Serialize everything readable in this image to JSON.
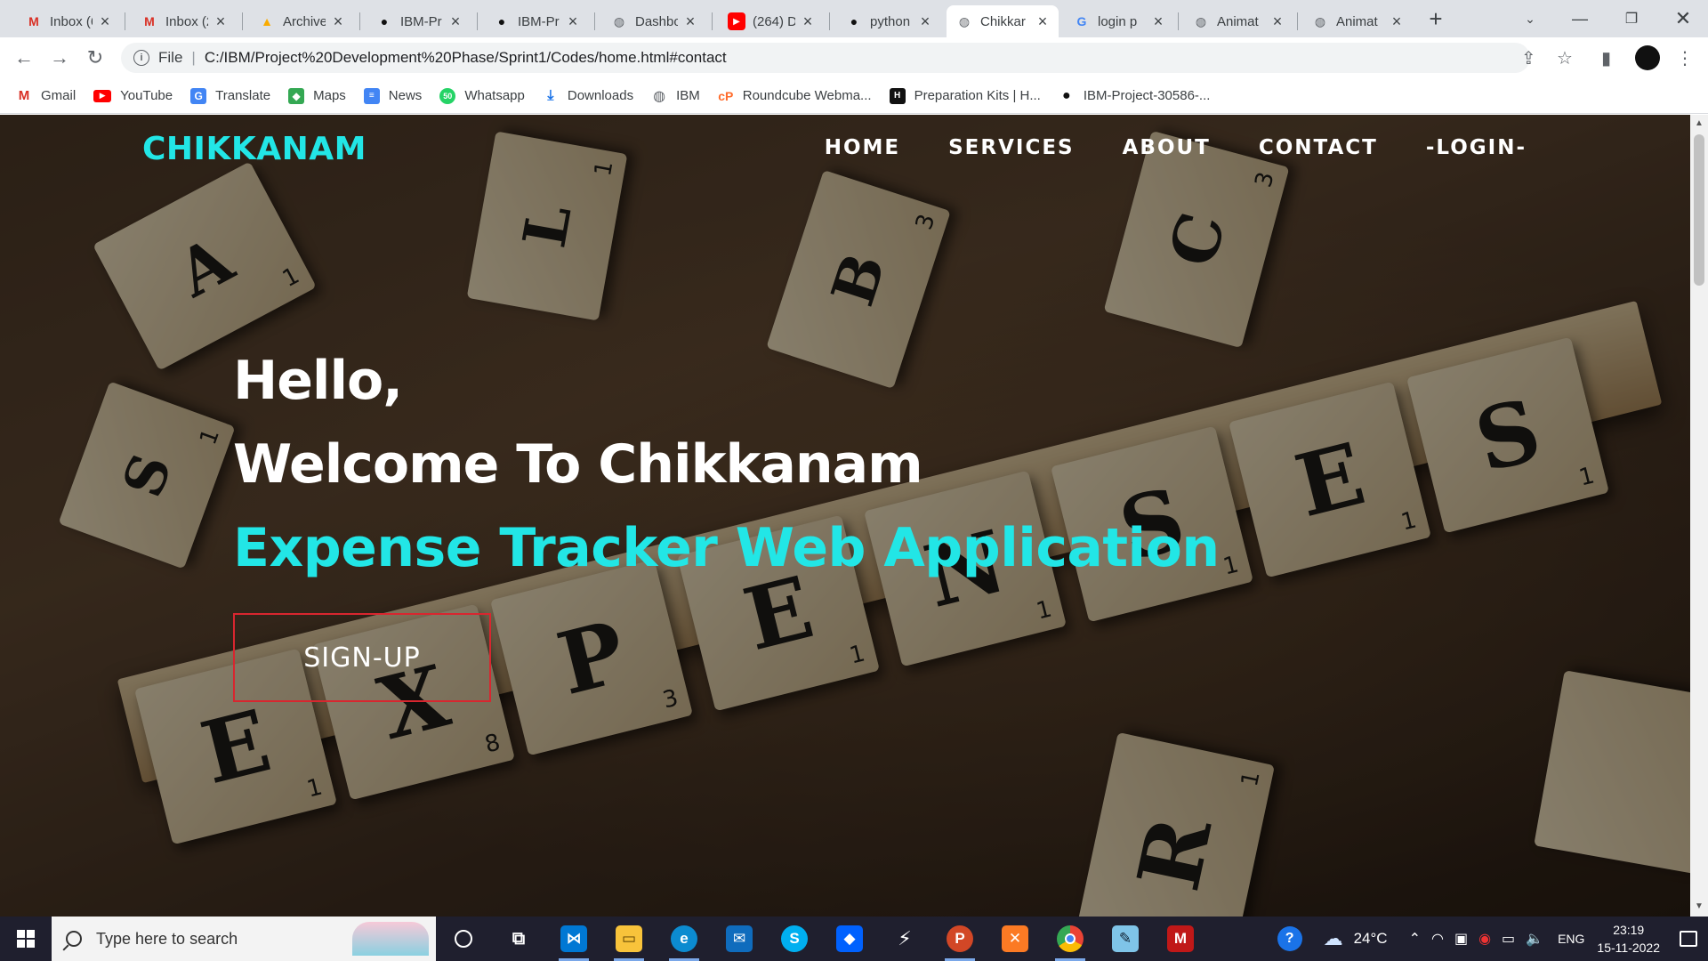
{
  "browser": {
    "tabs": [
      {
        "label": "Inbox (6",
        "icon": "gmail-icon"
      },
      {
        "label": "Inbox (2",
        "icon": "gmail-icon"
      },
      {
        "label": "Archive",
        "icon": "drive-icon"
      },
      {
        "label": "IBM-Pr",
        "icon": "github-icon"
      },
      {
        "label": "IBM-Pr",
        "icon": "github-icon"
      },
      {
        "label": "Dashbo",
        "icon": "globe-icon"
      },
      {
        "label": "(264) D",
        "icon": "youtube-icon"
      },
      {
        "label": "python",
        "icon": "github-icon"
      },
      {
        "label": "Chikkar",
        "icon": "globe-icon",
        "active": true
      },
      {
        "label": "login p",
        "icon": "google-icon"
      },
      {
        "label": "Animat",
        "icon": "globe-icon"
      },
      {
        "label": "Animat",
        "icon": "globe-icon"
      }
    ],
    "address": {
      "scheme": "File",
      "url": "C:/IBM/Project%20Development%20Phase/Sprint1/Codes/home.html#contact"
    },
    "bookmarks": [
      {
        "label": "Gmail"
      },
      {
        "label": "YouTube"
      },
      {
        "label": "Translate"
      },
      {
        "label": "Maps"
      },
      {
        "label": "News"
      },
      {
        "label": "Whatsapp"
      },
      {
        "label": "Downloads"
      },
      {
        "label": "IBM"
      },
      {
        "label": "Roundcube Webma..."
      },
      {
        "label": "Preparation Kits | H..."
      },
      {
        "label": "IBM-Project-30586-..."
      }
    ]
  },
  "site": {
    "logo": "CHIKKANAM",
    "nav": [
      "HOME",
      "SERVICES",
      "ABOUT",
      "CONTACT",
      "-LOGIN-"
    ],
    "hero": {
      "line1": "Hello,",
      "line2": "Welcome To Chikkanam",
      "line3": "Expense Tracker Web Application",
      "button": "SIGN-UP"
    },
    "background_tiles": [
      "A",
      "L",
      "B",
      "C",
      "S",
      "E",
      "X",
      "P",
      "E",
      "N",
      "S",
      "E",
      "S",
      "R"
    ],
    "background_tile_numbers": [
      "1",
      "1",
      "3",
      "3",
      "1",
      "1",
      "8",
      "3",
      "1",
      "1",
      "1",
      "1",
      "1",
      "1"
    ]
  },
  "taskbar": {
    "search_placeholder": "Type here to search",
    "weather": "24°C",
    "language": "ENG",
    "time": "23:19",
    "date": "15-11-2022"
  },
  "colors": {
    "accent": "#22e6e6",
    "button_border": "#d8262f"
  }
}
